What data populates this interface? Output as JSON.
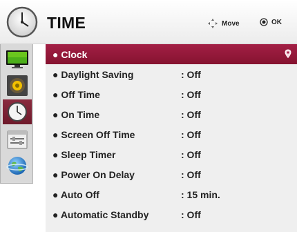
{
  "header": {
    "title": "TIME",
    "move_label": "Move",
    "ok_label": "OK"
  },
  "sidebar": {
    "items": [
      {
        "icon": "tv-picture-icon",
        "active": false
      },
      {
        "icon": "speaker-icon",
        "active": false
      },
      {
        "icon": "clock-icon",
        "active": true
      },
      {
        "icon": "settings-icon",
        "active": false
      },
      {
        "icon": "globe-icon",
        "active": false
      }
    ]
  },
  "menu": {
    "items": [
      {
        "label": "● Clock",
        "value": ""
      },
      {
        "label": "● Daylight Saving",
        "value": ": Off"
      },
      {
        "label": "● Off Time",
        "value": ": Off"
      },
      {
        "label": "● On Time",
        "value": ": Off"
      },
      {
        "label": "● Screen Off Time",
        "value": ": Off"
      },
      {
        "label": "● Sleep Timer",
        "value": ": Off"
      },
      {
        "label": "● Power On Delay",
        "value": ": Off"
      },
      {
        "label": "● Auto Off",
        "value": ": 15 min."
      },
      {
        "label": "● Automatic Standby",
        "value": ": Off"
      }
    ],
    "selected_index": 0
  },
  "colors": {
    "selected_row": "#a31f45",
    "active_sidebar": "#7a2233"
  }
}
